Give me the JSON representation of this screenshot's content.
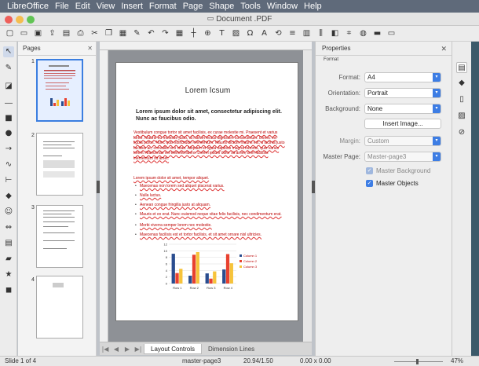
{
  "menubar": {
    "items": [
      "LibreOffice",
      "File",
      "Edit",
      "View",
      "Insert",
      "Format",
      "Page",
      "Shape",
      "Tools",
      "Window",
      "Help"
    ]
  },
  "window": {
    "title": "Document .PDF"
  },
  "toolbar": {
    "icons": [
      "new-icon",
      "open-icon",
      "save-icon",
      "export-icon",
      "export-pdf-icon",
      "print-icon",
      "cut-icon",
      "copy-icon",
      "paste-icon",
      "clone-icon",
      "undo-icon",
      "redo-icon",
      "grid-icon",
      "helplines-icon",
      "zoom-icon",
      "text-icon",
      "image-icon",
      "special-char-icon",
      "fontwork-icon",
      "transform-icon",
      "align-icon",
      "arrange-icon",
      "distribute-icon",
      "shadow-icon",
      "crop-icon",
      "filter-icon",
      "toggle-extrusion-icon",
      "show-draw-functions-icon"
    ]
  },
  "left_tools": {
    "icons": [
      "select-icon",
      "line-color-icon",
      "fill-color-icon",
      "line-icon",
      "rectangle-icon",
      "ellipse-icon",
      "arrow-icon",
      "curve-icon",
      "connector-icon",
      "basic-shapes-icon",
      "symbol-shapes-icon",
      "block-arrows-icon",
      "flowchart-icon",
      "callout-icon",
      "stars-icon",
      "3d-objects-icon"
    ]
  },
  "pages_panel": {
    "title": "Pages",
    "page_numbers": [
      "1",
      "2",
      "3",
      "4"
    ]
  },
  "document": {
    "heading": "Lorem Icsum",
    "subheading": "Lorem ipsum dolor sit amet, consectetur adipiscing elit. Nunc ac faucibus odio.",
    "para1": "Vestibulum congue tortor sit amet facilisis, ex curae molestie mi. Praesent et varius tortor. Mauris eu molestie justo, at rutrum lectus dignissim consectetuer. Donec vel ligula purus. Nunc quis sollicitudin elementum. Mauris dictum mauris est, a lacinia justo facilisis ac, convallis orci vitae. Aliquam et ligula dapibus magna lobortis, quis varius lorem. Maecenas vel eleifend libero. Lorem ipsum dolor sit amet, sem facilisis elementum sit amet.",
    "para2": "Lorem ipsum dolor sit amet, tempor aliquet.",
    "bullets": [
      "Maecenas non lorem sed aliquet placerat varius.",
      "Nulla luctus.",
      "Aenean congue fringilla justo at aliquam.",
      "Mauris et ex erat. Nunc euismod neque vitae felis facilisis, nec condimentum erat.",
      "Morbi viverra semper lorem nec molestie.",
      "Maecenas facilisis est et tortor facilisis, et sit amet ornare nisl ultricies."
    ],
    "chart": {
      "categories": [
        "Row 1",
        "Row 2",
        "Row 3",
        "Row 4"
      ],
      "series": [
        {
          "name": "Column 1",
          "color": "#2a4d8f",
          "values": [
            9.1,
            2.4,
            3.1,
            4.3
          ]
        },
        {
          "name": "Column 2",
          "color": "#e8412f",
          "values": [
            3.2,
            8.8,
            1.5,
            9.0
          ]
        },
        {
          "name": "Column 3",
          "color": "#f6c33b",
          "values": [
            4.5,
            9.6,
            3.7,
            6.2
          ]
        }
      ],
      "y_ticks": [
        "0",
        "2",
        "4",
        "6",
        "8",
        "10",
        "12"
      ]
    }
  },
  "bottom_tabs": {
    "nav": [
      "|◀",
      "◀",
      "▶",
      "▶|"
    ],
    "tabs": [
      "Layout Controls",
      "Dimension Lines"
    ]
  },
  "properties": {
    "title": "Properties",
    "section": "Format",
    "format_label": "Format:",
    "format_value": "A4",
    "orientation_label": "Orientation:",
    "orientation_value": "Portrait",
    "background_label": "Background:",
    "background_value": "None",
    "insert_image_label": "Insert Image...",
    "margin_label": "Margin:",
    "margin_value": "Custom",
    "master_page_label": "Master Page:",
    "master_page_value": "Master-page3",
    "master_background_label": "Master Background",
    "master_objects_label": "Master Objects"
  },
  "side_tabs": {
    "icons": [
      "properties-icon",
      "styles-icon",
      "gallery-icon",
      "navigator-icon",
      "functions-icon"
    ]
  },
  "status": {
    "slide": "Slide 1 of 4",
    "master": "master-page3",
    "position": "20.94/1.50",
    "size": "0.00 x 0.00",
    "zoom": "47%"
  }
}
